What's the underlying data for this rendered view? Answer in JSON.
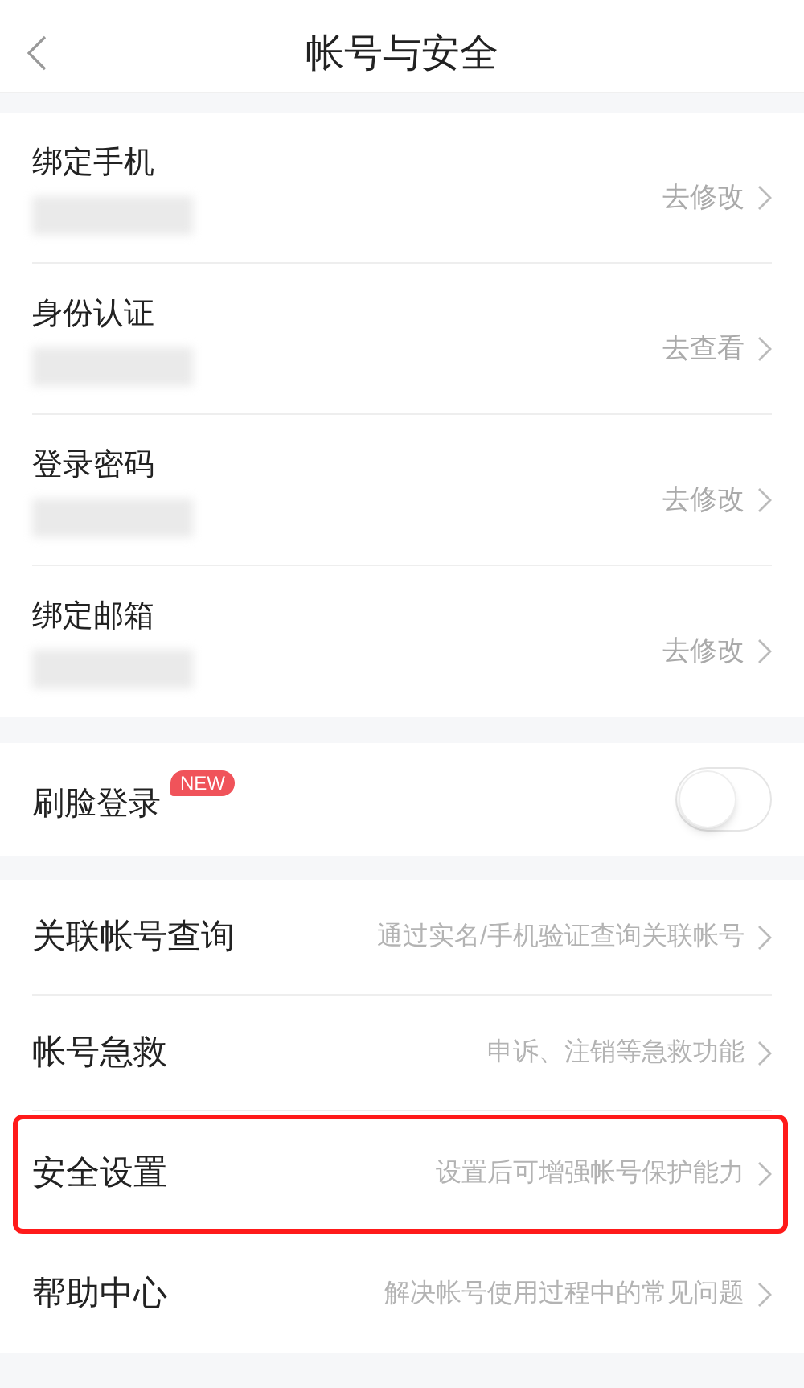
{
  "header": {
    "title": "帐号与安全"
  },
  "account_rows": [
    {
      "label": "绑定手机",
      "action": "去修改"
    },
    {
      "label": "身份认证",
      "action": "去查看"
    },
    {
      "label": "登录密码",
      "action": "去修改"
    },
    {
      "label": "绑定邮箱",
      "action": "去修改"
    }
  ],
  "face_login": {
    "label": "刷脸登录",
    "badge": "NEW",
    "on": false
  },
  "more_rows": [
    {
      "label": "关联帐号查询",
      "hint": "通过实名/手机验证查询关联帐号",
      "highlighted": false
    },
    {
      "label": "帐号急救",
      "hint": "申诉、注销等急救功能",
      "highlighted": false
    },
    {
      "label": "安全设置",
      "hint": "设置后可增强帐号保护能力",
      "highlighted": true
    },
    {
      "label": "帮助中心",
      "hint": "解决帐号使用过程中的常见问题",
      "highlighted": false
    }
  ]
}
